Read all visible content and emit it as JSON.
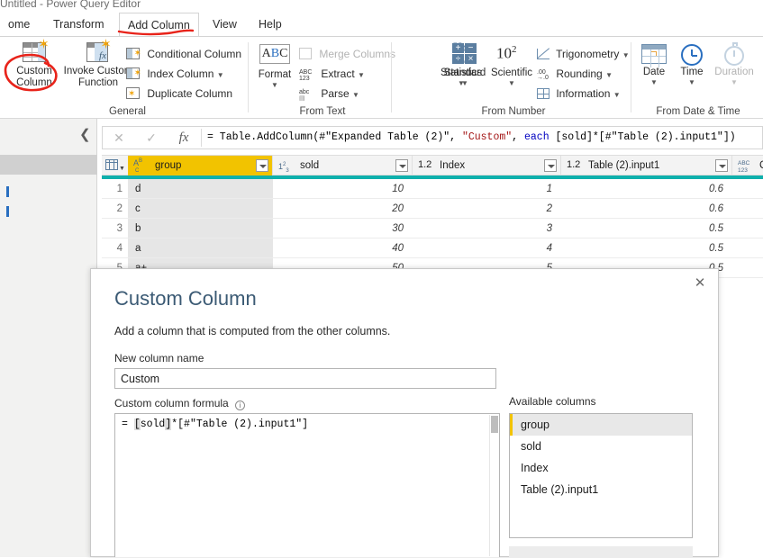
{
  "window": {
    "title": "Untitled - Power Query Editor"
  },
  "ribbon": {
    "tabs": [
      {
        "label": "ome",
        "active": false
      },
      {
        "label": "Transform",
        "active": false
      },
      {
        "label": "Add Column",
        "active": true
      },
      {
        "label": "View",
        "active": false
      },
      {
        "label": "Help",
        "active": false
      }
    ],
    "groups": [
      {
        "title": "General"
      },
      {
        "title": "From Text"
      },
      {
        "title": "From Number"
      },
      {
        "title": "From Date & Time"
      }
    ],
    "general": {
      "custom_column": "Custom\nColumn",
      "custom_column_line1": "Custom",
      "custom_column_line2": "Column",
      "invoke_custom_function_line1": "Invoke Custom",
      "invoke_custom_function_line2": "Function",
      "conditional_column": "Conditional Column",
      "index_column": "Index Column",
      "duplicate_column": "Duplicate Column"
    },
    "from_text": {
      "format": "Format",
      "merge_columns": "Merge Columns",
      "extract": "Extract",
      "parse": "Parse"
    },
    "from_number": {
      "statistics": "Statistics",
      "standard": "Standard",
      "scientific": "Scientific",
      "scientific_glyph": "10",
      "scientific_exp": "2",
      "trigonometry": "Trigonometry",
      "rounding": "Rounding",
      "information": "Information"
    },
    "from_date_time": {
      "date": "Date",
      "time": "Time",
      "duration": "Duration"
    }
  },
  "formula_bar": {
    "cancel_icon": "✕",
    "accept_icon": "✓",
    "fx_icon": "fx",
    "segments": [
      {
        "text": "= Table.AddColumn(#\"Expanded Table (2)\", ",
        "style": "plain"
      },
      {
        "text": "\"Custom\"",
        "style": "string"
      },
      {
        "text": ", ",
        "style": "plain"
      },
      {
        "text": "each",
        "style": "keyword"
      },
      {
        "text": " [sold]*[#\"Table (2).input1\"])",
        "style": "plain"
      }
    ]
  },
  "grid": {
    "columns": [
      {
        "name": "group",
        "type_icon": "ABC",
        "type_sub": "A B C",
        "selected": true
      },
      {
        "name": "sold",
        "type_icon": "123",
        "type_sub": "1 2 3",
        "selected": false
      },
      {
        "name": "Index",
        "type_icon": "1.2",
        "type_sub": "1.2",
        "selected": false
      },
      {
        "name": "Table (2).input1",
        "type_icon": "1.2",
        "type_sub": "1.2",
        "selected": false
      },
      {
        "name": "Custom",
        "type_icon": "ABC123",
        "type_sub": "ABC 123",
        "selected": false
      }
    ],
    "rows": [
      {
        "num": "1",
        "group": "d",
        "sold": "10",
        "index": "1",
        "input1": "0.6",
        "custom": ""
      },
      {
        "num": "2",
        "group": "c",
        "sold": "20",
        "index": "2",
        "input1": "0.6",
        "custom": ""
      },
      {
        "num": "3",
        "group": "b",
        "sold": "30",
        "index": "3",
        "input1": "0.5",
        "custom": ""
      },
      {
        "num": "4",
        "group": "a",
        "sold": "40",
        "index": "4",
        "input1": "0.5",
        "custom": ""
      },
      {
        "num": "5",
        "group": "a+",
        "sold": "50",
        "index": "5",
        "input1": "0.5",
        "custom": ""
      }
    ]
  },
  "dialog": {
    "close_icon": "✕",
    "title": "Custom Column",
    "subtitle": "Add a column that is computed from the other columns.",
    "new_column_name_label": "New column name",
    "new_column_name_value": "Custom",
    "formula_label": "Custom column formula",
    "info_icon": "i",
    "formula_segments": [
      {
        "text": "= ",
        "style": "plain"
      },
      {
        "text": "[",
        "style": "bracket"
      },
      {
        "text": "sold",
        "style": "plain"
      },
      {
        "text": "]",
        "style": "bracket"
      },
      {
        "text": "*[#\"Table (2).input1\"]",
        "style": "plain"
      }
    ],
    "available_columns_label": "Available columns",
    "available_columns": [
      {
        "label": "group",
        "selected": true
      },
      {
        "label": "sold",
        "selected": false
      },
      {
        "label": "Index",
        "selected": false
      },
      {
        "label": "Table (2).input1",
        "selected": false
      }
    ]
  },
  "annotations": {
    "tab_underline_color": "#e8231a",
    "custom_column_circle_color": "#e8231a"
  },
  "colors": {
    "accent_teal": "#0fb0ac",
    "selected_column": "#f2c300",
    "title_blue": "#3b5a74",
    "string_red": "#a31515",
    "keyword_blue": "#0000c0"
  }
}
